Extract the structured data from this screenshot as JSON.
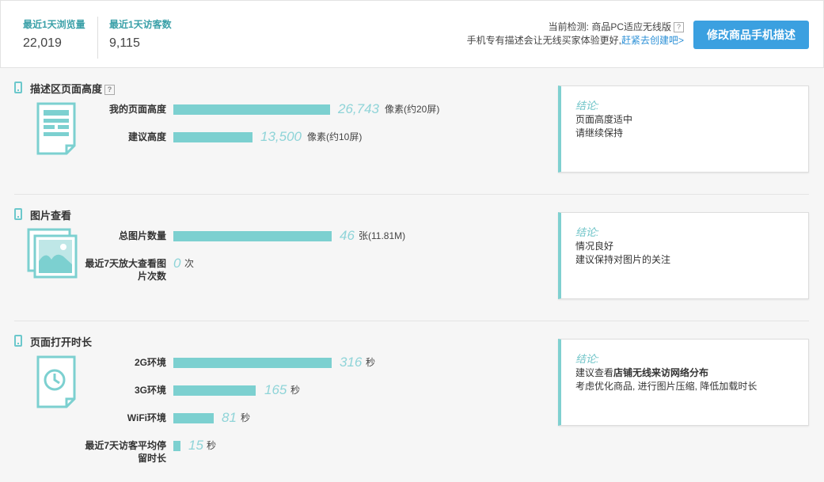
{
  "header": {
    "stats": [
      {
        "label": "最近1天浏览量",
        "value": "22,019"
      },
      {
        "label": "最近1天访客数",
        "value": "9,115"
      }
    ],
    "detect_line": "当前检测: 商品PC适应无线版",
    "hint_text": "手机专有描述会让无线买家体验更好,",
    "hint_link": "赶紧去创建吧>",
    "help_glyph": "?",
    "primary_button": "修改商品手机描述"
  },
  "sections": [
    {
      "title": "描述区页面高度",
      "rows": [
        {
          "label": "我的页面高度",
          "value": "26,743",
          "unit": "像素(约20屏)"
        },
        {
          "label": "建议高度",
          "value": "13,500",
          "unit": "像素(约10屏)"
        }
      ],
      "card": {
        "title": "结论:",
        "lines": [
          "页面高度适中",
          "请继续保持"
        ]
      }
    },
    {
      "title": "图片查看",
      "rows": [
        {
          "label": "总图片数量",
          "value": "46",
          "unit": "张(11.81M)"
        },
        {
          "label": "最近7天放大查看图片次数",
          "value": "0",
          "unit": "次"
        }
      ],
      "card": {
        "title": "结论:",
        "lines": [
          "情况良好",
          "建议保持对图片的关注"
        ]
      }
    },
    {
      "title": "页面打开时长",
      "rows": [
        {
          "label": "2G环境",
          "value": "316",
          "unit": "秒"
        },
        {
          "label": "3G环境",
          "value": "165",
          "unit": "秒"
        },
        {
          "label": "WiFi环境",
          "value": "81",
          "unit": "秒"
        },
        {
          "label": "最近7天访客平均停留时长",
          "value": "15",
          "unit": "秒"
        }
      ],
      "card": {
        "title": "结论:",
        "line1_prefix": "建议查看",
        "line1_bold": "店铺无线来访网络分布",
        "line2": "考虑优化商品, 进行图片压缩, 降低加载时长"
      }
    }
  ],
  "icons": [
    "phone-icon",
    "page-layout-icon",
    "image-icon",
    "clock-icon"
  ],
  "colors": {
    "accent": "#7cd0d0",
    "button": "#3ba0e0",
    "label": "#3aa0a8",
    "link": "#2a8fd6"
  }
}
